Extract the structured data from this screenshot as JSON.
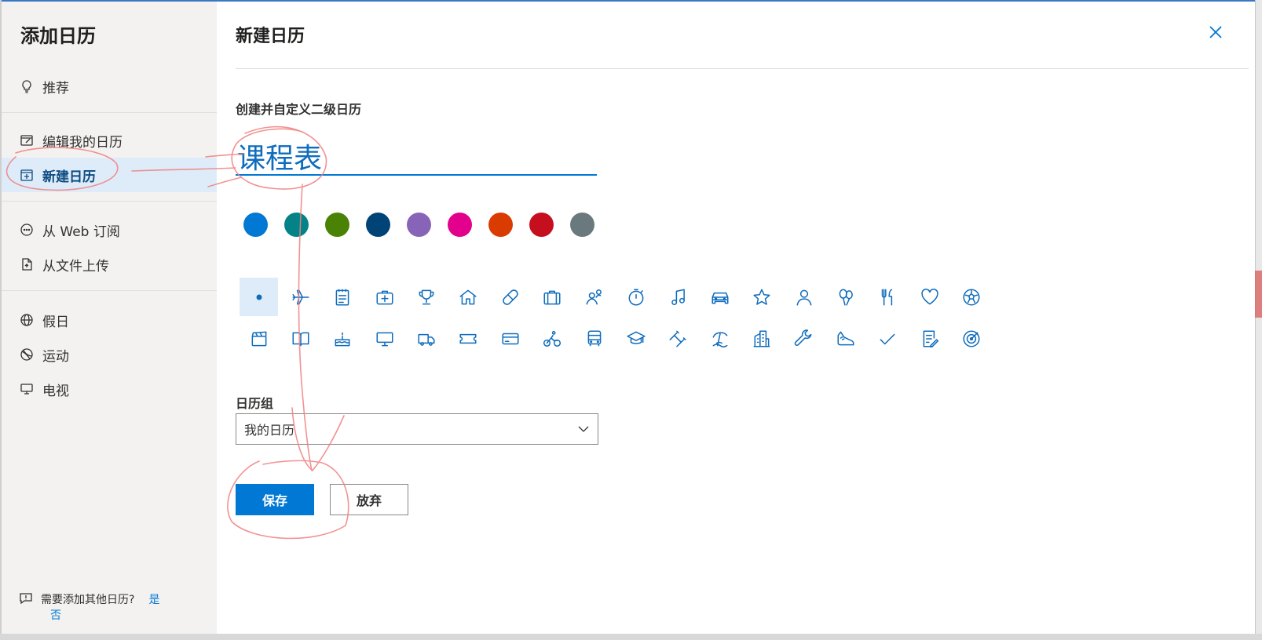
{
  "sidebar": {
    "title": "添加日历",
    "items": [
      {
        "key": "recommended",
        "label": "推荐",
        "icon": "lightbulb-icon"
      },
      {
        "key": "edit",
        "label": "编辑我的日历",
        "icon": "edit-calendar-icon"
      },
      {
        "key": "new",
        "label": "新建日历",
        "icon": "calendar-add-icon",
        "active": true
      },
      {
        "key": "web",
        "label": "从 Web 订阅",
        "icon": "more-circle-icon"
      },
      {
        "key": "upload",
        "label": "从文件上传",
        "icon": "file-upload-icon"
      },
      {
        "key": "holidays",
        "label": "假日",
        "icon": "globe-icon"
      },
      {
        "key": "sports",
        "label": "运动",
        "icon": "sports-ball-icon"
      },
      {
        "key": "tv",
        "label": "电视",
        "icon": "tv-icon"
      }
    ],
    "footer": {
      "text": "需要添加其他日历?",
      "yes": "是",
      "no": "否",
      "icon": "feedback-icon"
    }
  },
  "main": {
    "title": "新建日历",
    "close_icon": "close-icon",
    "subtitle": "创建并自定义二级日历",
    "name_value": "课程表",
    "colors": [
      "#0078d4",
      "#038387",
      "#498205",
      "#004377",
      "#8764b8",
      "#e3008c",
      "#da3b01",
      "#c50f1f",
      "#69797e"
    ],
    "icons_row1": [
      "dot-icon",
      "airplane-icon",
      "notepad-icon",
      "first-aid-icon",
      "trophy-icon",
      "home-icon",
      "pill-icon",
      "briefcase-icon",
      "people-icon",
      "stopwatch-icon",
      "music-note-icon",
      "car-icon",
      "star-icon",
      "person-icon",
      "balloons-icon",
      "utensils-icon",
      "heart-icon",
      "soccer-ball-icon"
    ],
    "icons_row2": [
      "clapperboard-icon",
      "book-icon",
      "birthday-cake-icon",
      "monitor-icon",
      "truck-icon",
      "ticket-icon",
      "credit-card-icon",
      "cyclist-icon",
      "bus-icon",
      "graduation-cap-icon",
      "dumbbell-icon",
      "beach-icon",
      "building-icon",
      "wrench-icon",
      "sneaker-icon",
      "checkmark-icon",
      "notes-icon",
      "target-icon"
    ],
    "group_label": "日历组",
    "group_value": "我的日历",
    "save_label": "保存",
    "discard_label": "放弃"
  }
}
